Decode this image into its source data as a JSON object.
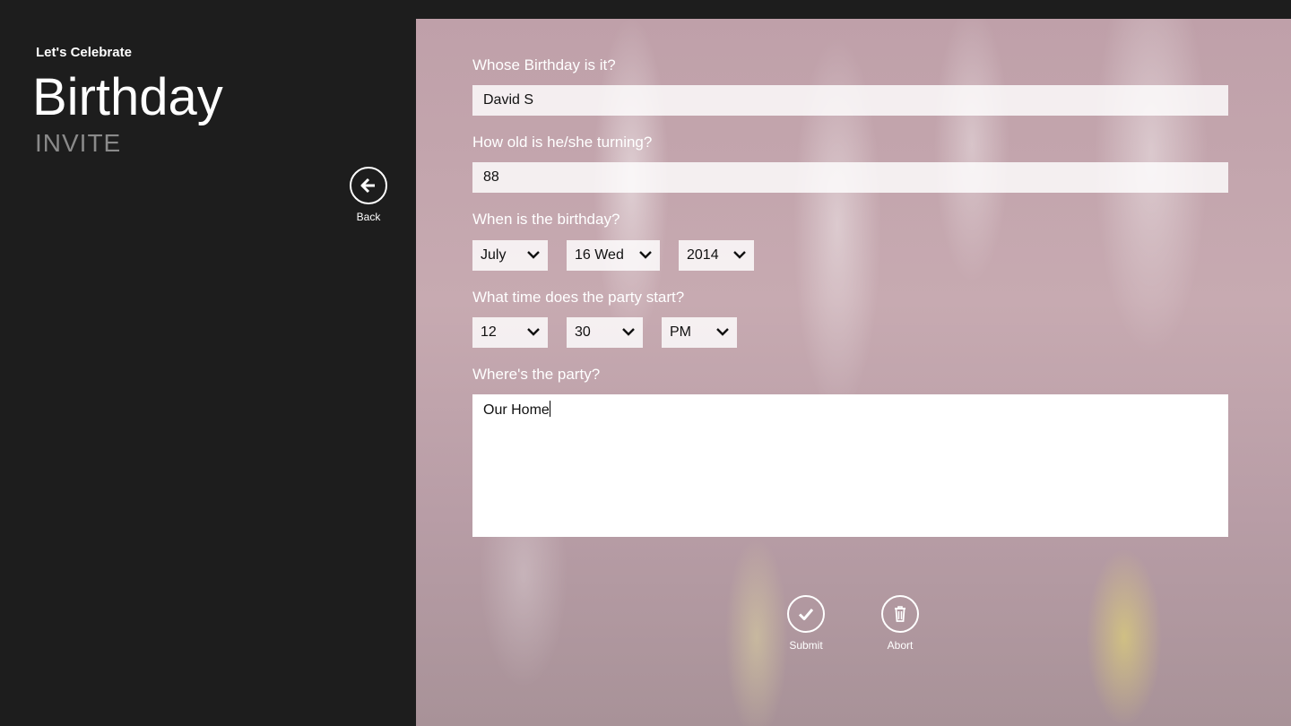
{
  "app": {
    "subtitle": "Let's Celebrate",
    "title": "Birthday",
    "tag": "INVITE"
  },
  "nav": {
    "back_label": "Back"
  },
  "form": {
    "name": {
      "label": "Whose Birthday is it?",
      "value": "David S"
    },
    "age": {
      "label": "How old is he/she turning?",
      "value": "88"
    },
    "date": {
      "label": "When is the birthday?",
      "month": "July",
      "day": "16 Wed",
      "year": "2014"
    },
    "time": {
      "label": "What time does the party start?",
      "hour": "12",
      "minute": "30",
      "ampm": "PM"
    },
    "location": {
      "label": "Where's the party?",
      "value": "Our Home"
    }
  },
  "actions": {
    "submit_label": "Submit",
    "abort_label": "Abort"
  },
  "colors": {
    "sidebar_bg": "#1d1d1d",
    "subtitle_gray": "#8a8a8a"
  },
  "icons": [
    "back-arrow-icon",
    "chevron-down-icon",
    "checkmark-icon",
    "trash-icon"
  ]
}
